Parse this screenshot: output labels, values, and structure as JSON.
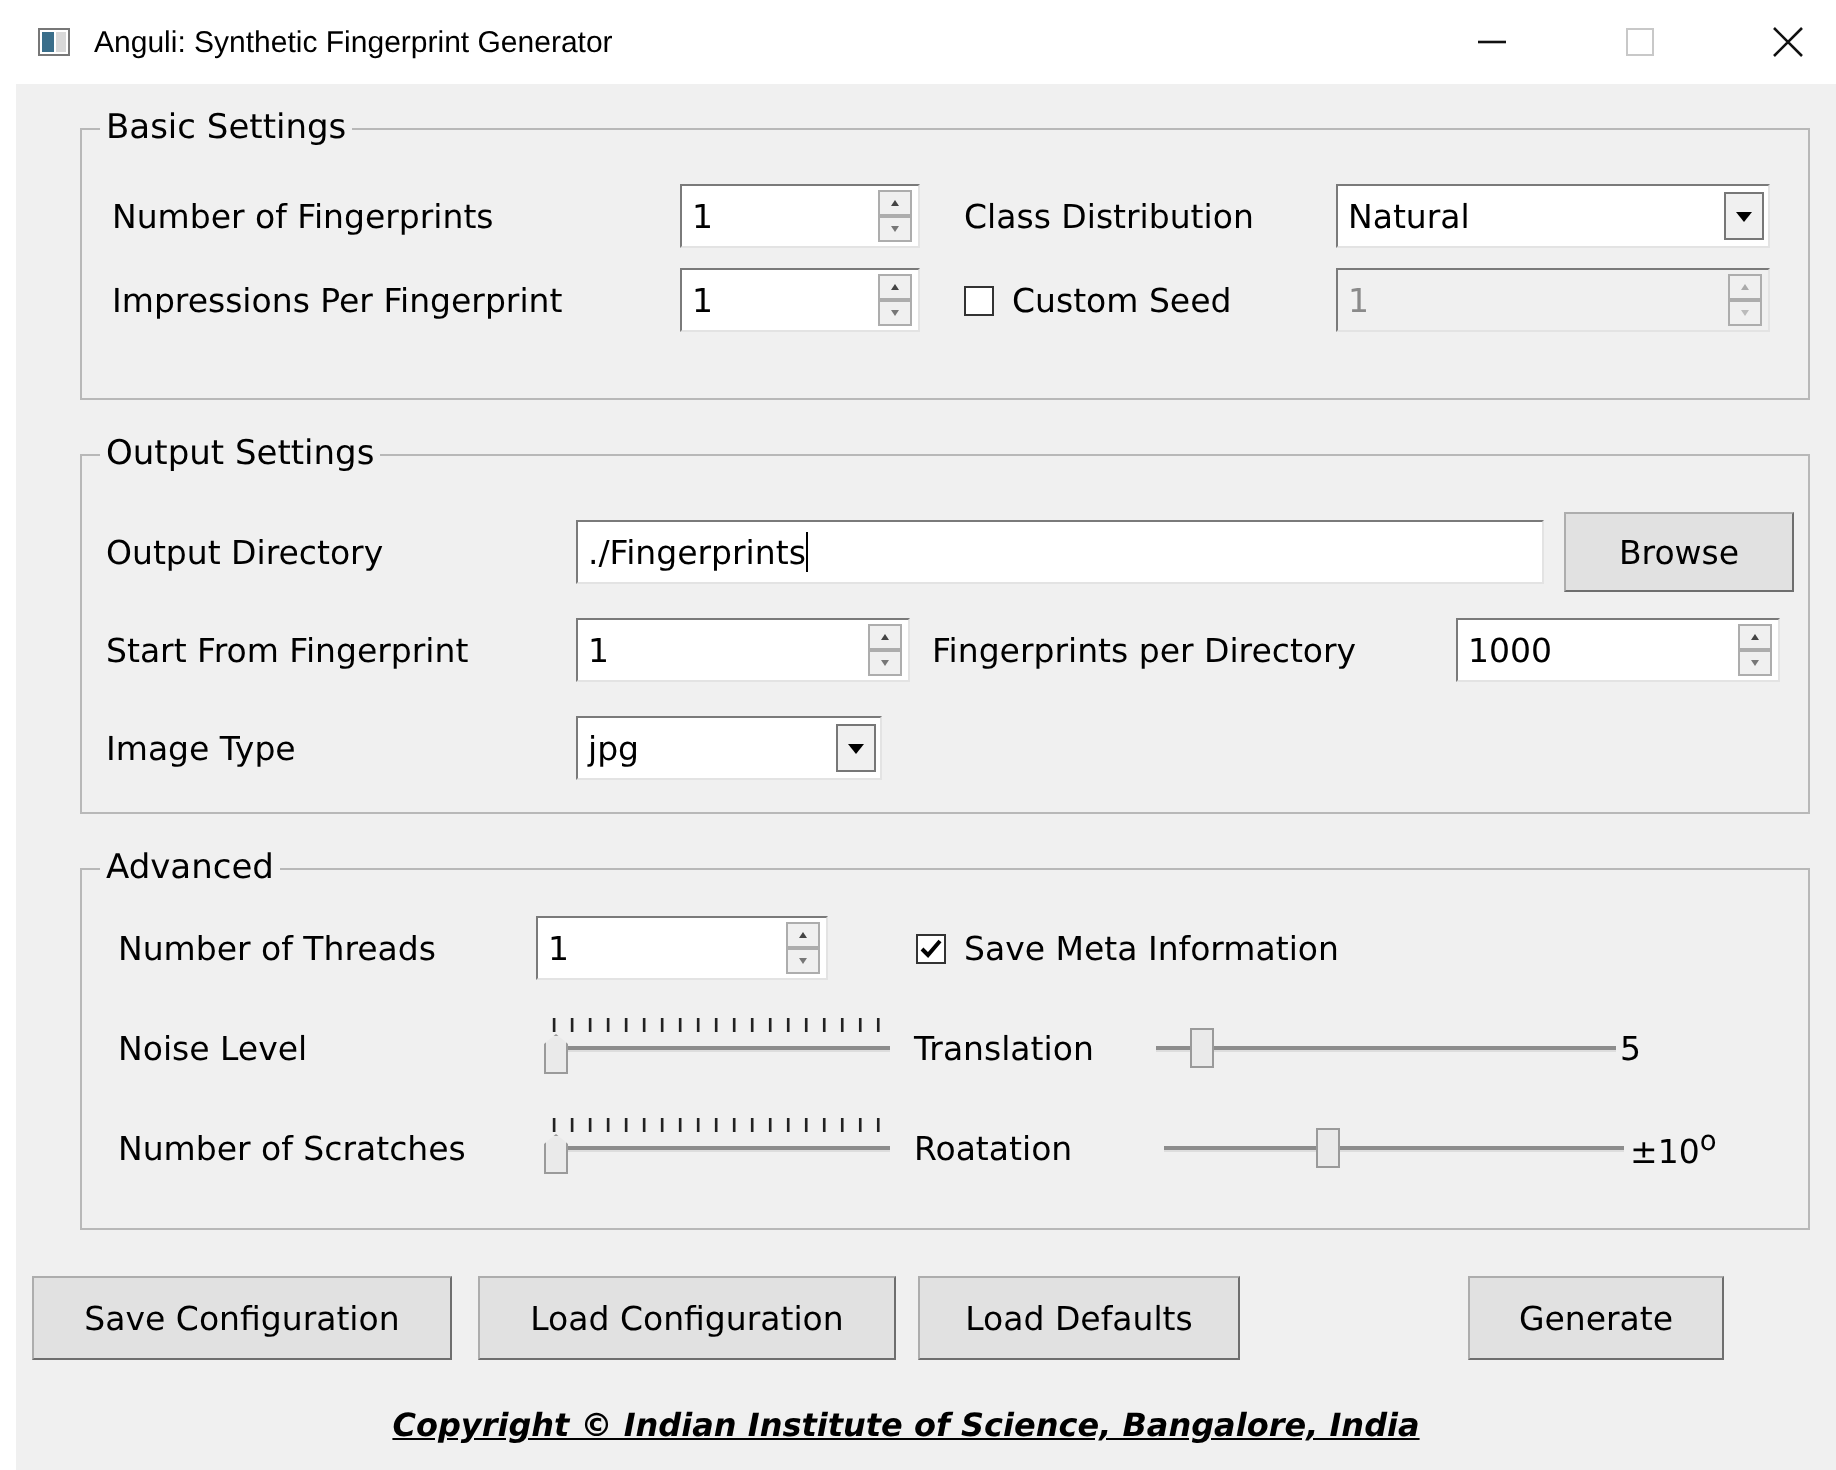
{
  "window": {
    "title": "Anguli: Synthetic Fingerprint Generator"
  },
  "groups": [
    {
      "title": "Basic Settings",
      "rows": [
        [
          {
            "kind": "label",
            "text": "Number of Fingerprints"
          },
          {
            "kind": "spin",
            "value": "1",
            "disabled": false
          },
          {
            "kind": "label",
            "text": "Class Distribution"
          },
          {
            "kind": "dropdown",
            "value": "Natural"
          }
        ],
        [
          {
            "kind": "label",
            "text": "Impressions Per Fingerprint"
          },
          {
            "kind": "spin",
            "value": "1",
            "disabled": false
          },
          {
            "kind": "checkbox",
            "label": "Custom Seed",
            "checked": false
          },
          {
            "kind": "spin",
            "value": "1",
            "disabled": true
          }
        ]
      ]
    },
    {
      "title": "Output Settings",
      "rows": [
        [
          {
            "kind": "label",
            "text": "Output Directory"
          },
          {
            "kind": "text_field",
            "value": "./Fingerprints"
          },
          {
            "kind": "button",
            "label": "Browse"
          }
        ],
        [
          {
            "kind": "label",
            "text": "Start From Fingerprint"
          },
          {
            "kind": "spin",
            "value": "1",
            "disabled": false
          },
          {
            "kind": "label",
            "text": "Fingerprints per Directory"
          },
          {
            "kind": "spin",
            "value": "1000",
            "disabled": false
          }
        ],
        [
          {
            "kind": "label",
            "text": "Image Type"
          },
          {
            "kind": "dropdown",
            "value": "jpg"
          }
        ]
      ]
    },
    {
      "title": "Advanced",
      "rows": [
        [
          {
            "kind": "label",
            "text": "Number of Threads"
          },
          {
            "kind": "spin",
            "value": "1",
            "disabled": false
          },
          {
            "kind": "checkbox",
            "label": "Save Meta Information",
            "checked": true
          }
        ],
        [
          {
            "kind": "label",
            "text": "Noise Level"
          },
          {
            "kind": "slider",
            "level": 0,
            "ticks": true
          },
          {
            "kind": "label",
            "text": "Translation"
          },
          {
            "kind": "slider",
            "level": 0.08,
            "ticks": false
          },
          {
            "kind": "label",
            "text": "5"
          }
        ],
        [
          {
            "kind": "label",
            "text": "Number of Scratches"
          },
          {
            "kind": "slider",
            "level": 0,
            "ticks": true
          },
          {
            "kind": "label",
            "text": "Roatation"
          },
          {
            "kind": "slider",
            "level": 0.35,
            "ticks": false
          },
          {
            "kind": "label",
            "text": "±10$^{o}$"
          }
        ]
      ]
    }
  ],
  "buttons": [
    "Save Configuration",
    "Load Configuration",
    "Load Defaults",
    "Generate"
  ],
  "copyright": "Copyright © Indian Institute of Science, Bangalore, India"
}
